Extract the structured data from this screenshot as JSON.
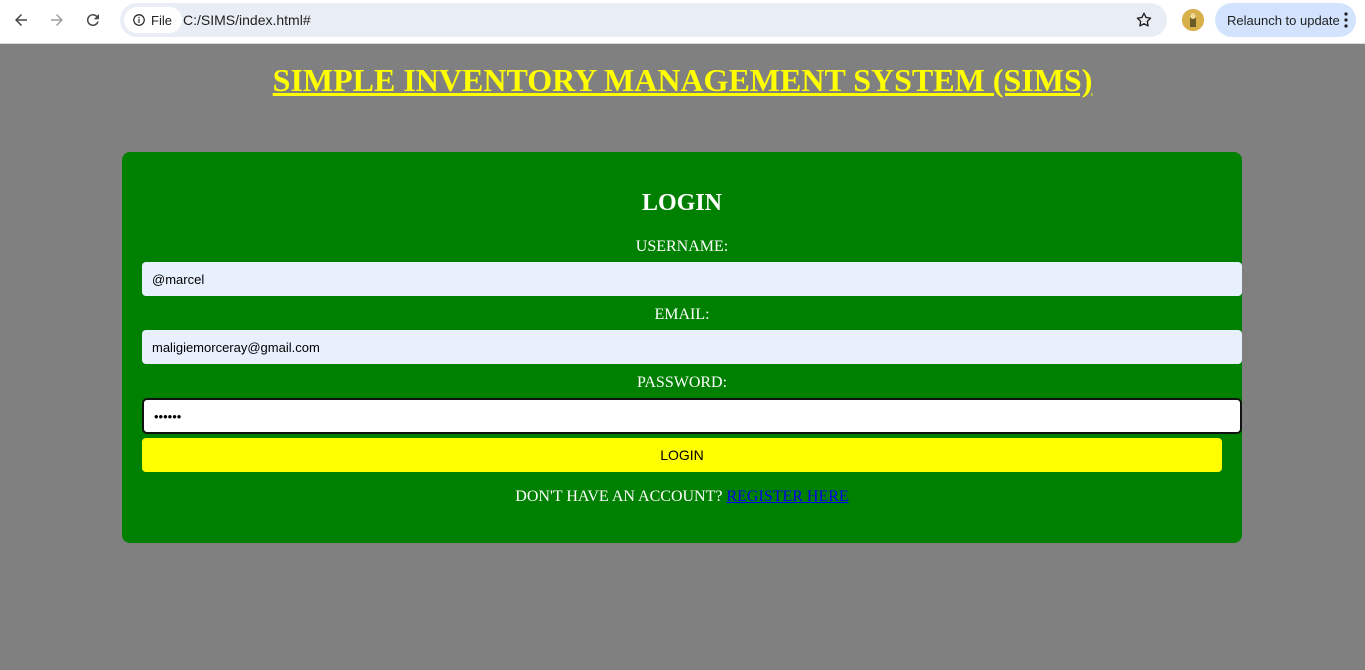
{
  "browser": {
    "chip_label": "File",
    "url": "C:/SIMS/index.html#",
    "relaunch_label": "Relaunch to update"
  },
  "page": {
    "title": "SIMPLE INVENTORY MANAGEMENT SYSTEM (SIMS)",
    "form": {
      "heading": "LOGIN",
      "username_label": "USERNAME:",
      "username_value": "@marcel",
      "email_label": "EMAIL:",
      "email_value": "maligiemorceray@gmail.com",
      "password_label": "PASSWORD:",
      "password_value": "••••••",
      "submit_label": "LOGIN",
      "register_prompt": "DON'T HAVE AN ACCOUNT?",
      "register_link": "REGISTER HERE"
    }
  },
  "colors": {
    "background": "#808080",
    "panel": "#008000",
    "title": "#ffff00",
    "button": "#ffff00",
    "link": "#0000ee"
  }
}
